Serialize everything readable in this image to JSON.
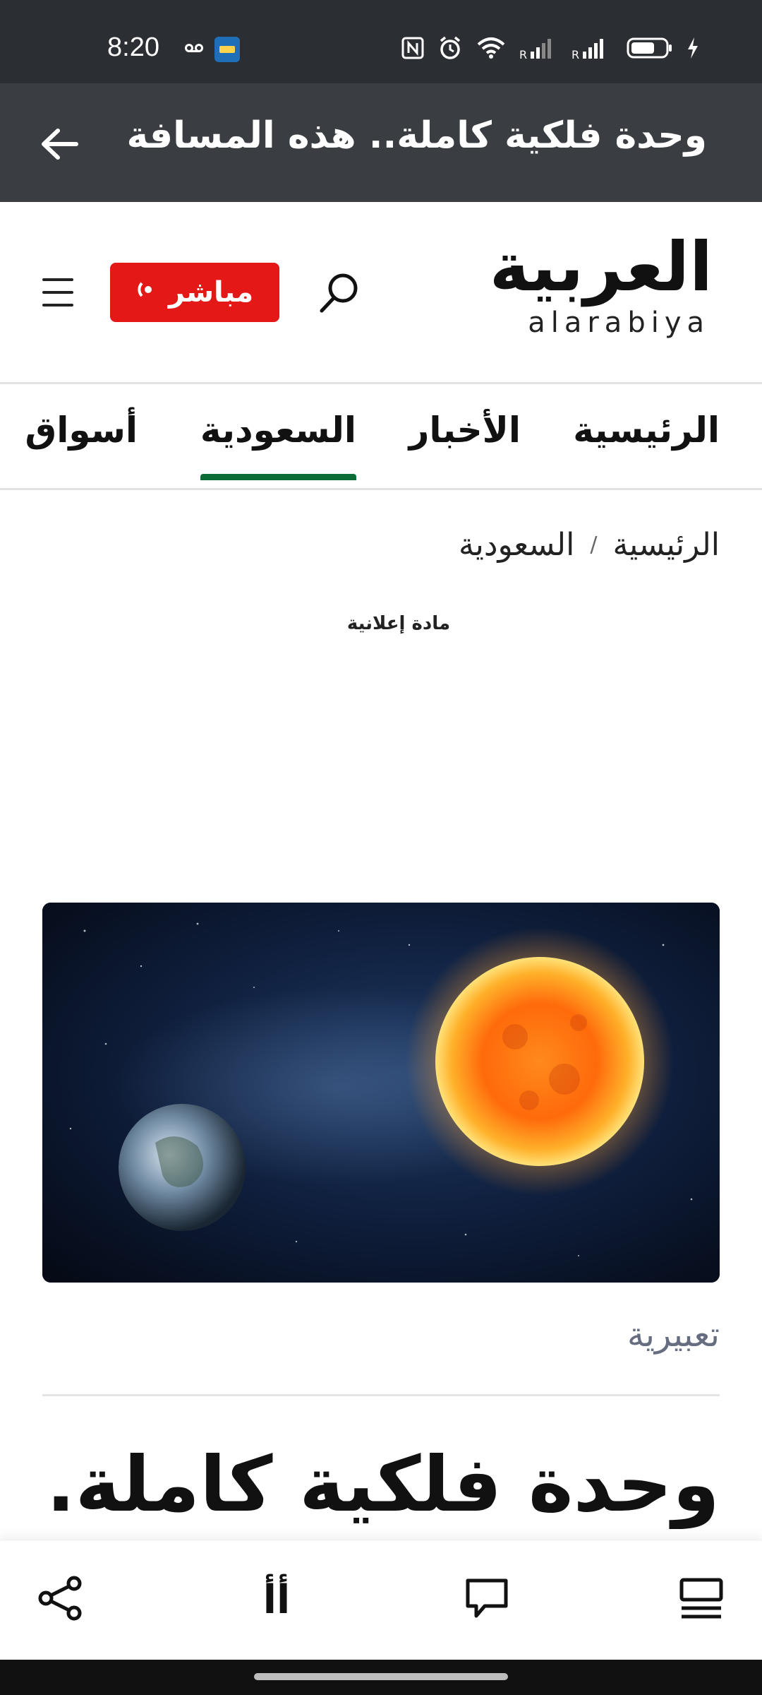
{
  "status_bar": {
    "time": "8:20",
    "icons": [
      "voicemail-icon",
      "etisalat-extra-app-icon",
      "nfc-icon",
      "alarm-icon",
      "wifi-icon",
      "signal-r-icon",
      "signal-r-icon",
      "battery-icon",
      "charging-icon"
    ]
  },
  "app_bar": {
    "title": "وحدة فلكية كاملة.. هذه المسافة ...",
    "back_icon": "arrow-left-icon"
  },
  "header": {
    "logo_arabic": "العربية",
    "logo_latin": "alarabiya",
    "live_label": "مباشر",
    "live_color": "#e51818",
    "search_icon": "search-icon",
    "menu_icon": "hamburger-menu-icon"
  },
  "nav": {
    "tabs": [
      {
        "label": "الرئيسية",
        "active": false
      },
      {
        "label": "الأخبار",
        "active": false
      },
      {
        "label": "السعودية",
        "active": true
      },
      {
        "label": "أسواق",
        "active": false
      }
    ],
    "active_color": "#0b6b36"
  },
  "breadcrumb": {
    "items": [
      "الرئيسية",
      "السعودية"
    ],
    "separator": "/"
  },
  "ad": {
    "label": "مادة إعلانية"
  },
  "article": {
    "image_description_icon": "sun-and-earth-illustration",
    "caption": "تعبيرية",
    "headline": "وحدة فلكية كاملة.."
  },
  "bottom_bar": {
    "share_icon": "share-icon",
    "font_size_label": "أأ",
    "comment_icon": "comment-icon",
    "reader_icon": "article-list-icon"
  }
}
